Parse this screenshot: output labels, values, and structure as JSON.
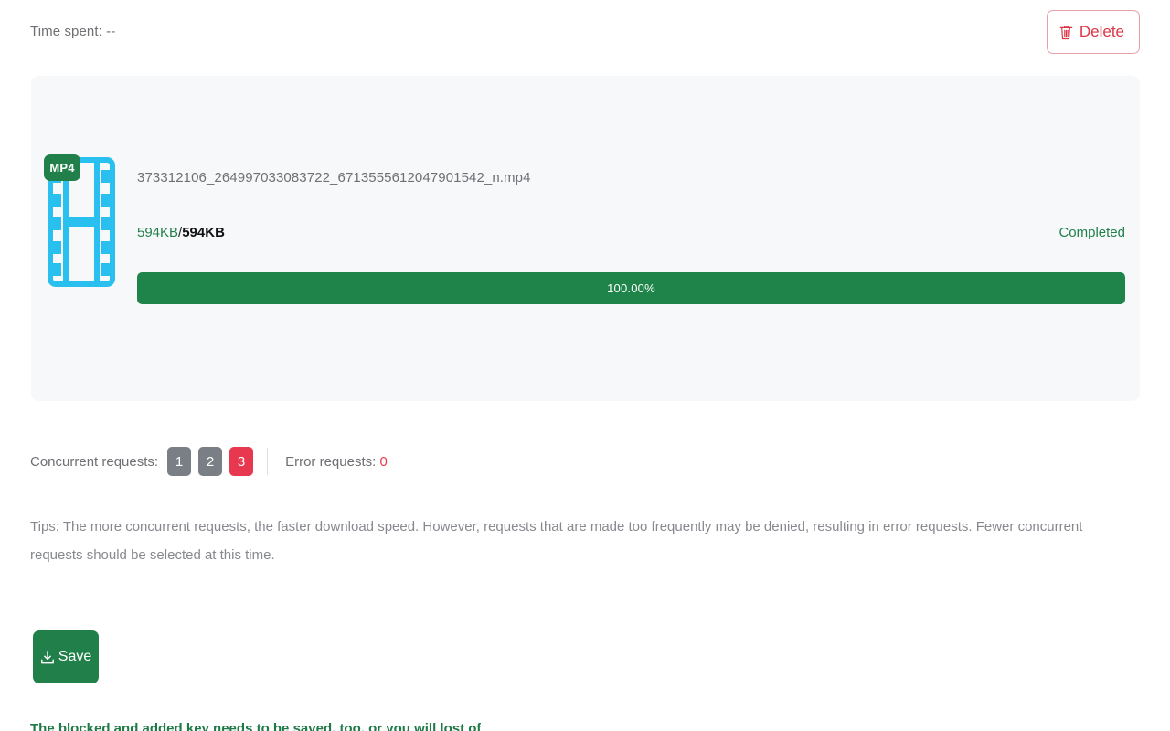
{
  "header": {
    "time_spent_label": "Time spent: --",
    "delete_button_label": "Delete",
    "delete_icon": "trash-icon"
  },
  "file": {
    "type_badge": "MP4",
    "type_icon": "film-strip-icon",
    "name": "373312106_264997033083722_6713555612047901542_n.mp4",
    "downloaded_size": "594KB",
    "size_separator": "/",
    "total_size": "594KB",
    "status": "Completed",
    "progress_percent_label": "100.00%",
    "progress_percent": 100
  },
  "concurrency": {
    "label": "Concurrent requests:",
    "options": [
      "1",
      "2",
      "3"
    ],
    "selected": "3",
    "error_label": "Error requests:",
    "error_count": "0"
  },
  "tips": {
    "text": "Tips: The more concurrent requests, the faster download speed. However, requests that are made too frequently may be denied, resulting in error requests. Fewer concurrent requests should be selected at this time."
  },
  "actions": {
    "save_label": "Save",
    "save_icon": "download-icon"
  },
  "bottom_notice": {
    "text": "The blocked and added key needs to be saved, too, or you will lost of"
  },
  "colors": {
    "green": "#21804a",
    "progress_green": "#1e8449",
    "red": "#e8384f",
    "delete_red": "#dc3545",
    "gray_badge": "#7a7f85",
    "card_bg": "#f7f8f9",
    "film_cyan": "#29c0ef"
  }
}
